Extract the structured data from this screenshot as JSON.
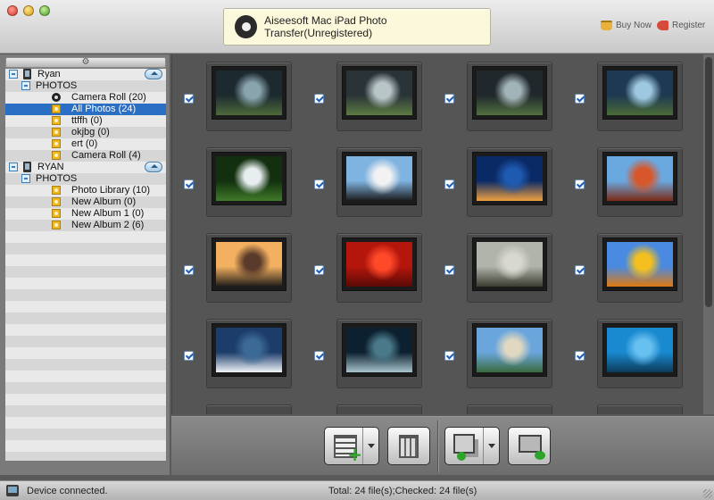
{
  "window": {
    "app_title": "Aiseesoft Mac iPad Photo Transfer(Unregistered)",
    "buy_now": "Buy Now",
    "register": "Register"
  },
  "tree": [
    {
      "type": "device",
      "label": "Ryan",
      "indent": 0
    },
    {
      "type": "folder",
      "label": "PHOTOS",
      "indent": 1
    },
    {
      "type": "camera",
      "label": "Camera Roll (20)",
      "indent": 2
    },
    {
      "type": "album",
      "label": "All Photos (24)",
      "indent": 2,
      "selected": true
    },
    {
      "type": "album",
      "label": "ttffh (0)",
      "indent": 2
    },
    {
      "type": "album",
      "label": "okjbg (0)",
      "indent": 2
    },
    {
      "type": "album",
      "label": "ert (0)",
      "indent": 2
    },
    {
      "type": "album",
      "label": "Camera Roll (4)",
      "indent": 2
    },
    {
      "type": "device",
      "label": "RYAN",
      "indent": 0
    },
    {
      "type": "folder",
      "label": "PHOTOS",
      "indent": 1
    },
    {
      "type": "album",
      "label": "Photo Library (10)",
      "indent": 2
    },
    {
      "type": "album",
      "label": "New Album (0)",
      "indent": 2
    },
    {
      "type": "album",
      "label": "New Album 1 (0)",
      "indent": 2
    },
    {
      "type": "album",
      "label": "New Album 2 (6)",
      "indent": 2
    }
  ],
  "photos": [
    {
      "name": "plant-glass-1",
      "checked": true,
      "colors": [
        "#1c2a30",
        "#8aa4ad",
        "#4d6a3a"
      ]
    },
    {
      "name": "plant-glass-2",
      "checked": true,
      "colors": [
        "#2a3438",
        "#b8c6c8",
        "#5c7b42"
      ]
    },
    {
      "name": "plant-glass-3",
      "checked": true,
      "colors": [
        "#20282c",
        "#a2b4b8",
        "#527040"
      ]
    },
    {
      "name": "plant-glass-4",
      "checked": true,
      "colors": [
        "#1e3a52",
        "#9ec8e0",
        "#4a6b36"
      ]
    },
    {
      "name": "white-flower",
      "checked": true,
      "colors": [
        "#12300f",
        "#e8eef0",
        "#3f7a2a"
      ]
    },
    {
      "name": "penguins",
      "checked": true,
      "colors": [
        "#7fb3e0",
        "#f2f2f2",
        "#1b1b1b"
      ]
    },
    {
      "name": "jellyfish",
      "checked": true,
      "colors": [
        "#0a2a66",
        "#1e5ab0",
        "#f0a040"
      ]
    },
    {
      "name": "desert",
      "checked": true,
      "colors": [
        "#6aa8e0",
        "#d8572a",
        "#7a2a14"
      ]
    },
    {
      "name": "lighthouse",
      "checked": true,
      "colors": [
        "#f2b060",
        "#5a3a2a",
        "#1e1a18"
      ]
    },
    {
      "name": "red-flower",
      "checked": true,
      "colors": [
        "#b4160c",
        "#ff4a2a",
        "#5a0a06"
      ]
    },
    {
      "name": "koala",
      "checked": true,
      "colors": [
        "#b0b4aa",
        "#d8d8d0",
        "#3a3c30"
      ]
    },
    {
      "name": "tulips",
      "checked": true,
      "colors": [
        "#4a8ae0",
        "#f4c020",
        "#e07a10"
      ]
    },
    {
      "name": "winter-night",
      "checked": true,
      "colors": [
        "#1c3c6a",
        "#3c6a96",
        "#f0f4f8"
      ]
    },
    {
      "name": "aurora",
      "checked": true,
      "colors": [
        "#0c2030",
        "#4a7a8a",
        "#a8c4cc"
      ]
    },
    {
      "name": "mountain-lake",
      "checked": true,
      "colors": [
        "#6aa6dc",
        "#e0d8c0",
        "#3a6a40"
      ]
    },
    {
      "name": "palm-sea",
      "checked": true,
      "colors": [
        "#1a8ad0",
        "#68c0f0",
        "#0c3a5a"
      ]
    }
  ],
  "status": {
    "device_state": "Device connected.",
    "summary": "Total: 24 file(s);Checked: 24 file(s)"
  },
  "colors": {
    "selection": "#2a6fc4",
    "check_mark": "#1c5fb8"
  }
}
